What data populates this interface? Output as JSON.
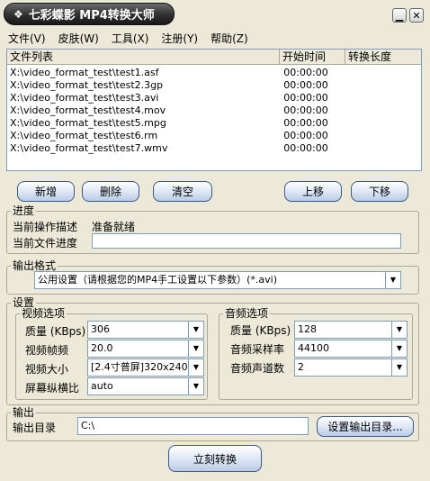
{
  "window": {
    "title": "七彩蝶影 MP4转换大师"
  },
  "menu": [
    "文件(V)",
    "皮肤(W)",
    "工具(X)",
    "注册(Y)",
    "帮助(Z)"
  ],
  "list": {
    "headers": [
      "文件列表",
      "开始时间",
      "转换长度"
    ],
    "rows": [
      {
        "file": "X:\\video_format_test\\test1.asf",
        "start": "00:00:00",
        "length": ""
      },
      {
        "file": "X:\\video_format_test\\test2.3gp",
        "start": "00:00:00",
        "length": ""
      },
      {
        "file": "X:\\video_format_test\\test3.avi",
        "start": "00:00:00",
        "length": ""
      },
      {
        "file": "X:\\video_format_test\\test4.mov",
        "start": "00:00:00",
        "length": ""
      },
      {
        "file": "X:\\video_format_test\\test5.mpg",
        "start": "00:00:00",
        "length": ""
      },
      {
        "file": "X:\\video_format_test\\test6.rm",
        "start": "00:00:00",
        "length": ""
      },
      {
        "file": "X:\\video_format_test\\test7.wmv",
        "start": "00:00:00",
        "length": ""
      }
    ]
  },
  "buttons": {
    "add": "新增",
    "delete": "删除",
    "clear": "清空",
    "up": "上移",
    "down": "下移"
  },
  "progress": {
    "group": "进度",
    "desc_label": "当前操作描述",
    "desc_value": "准备就绪",
    "file_label": "当前文件进度",
    "file_progress": 0
  },
  "format": {
    "group": "输出格式",
    "value": "公用设置（请根据您的MP4手工设置以下参数）(*.avi)"
  },
  "settings": {
    "group": "设置",
    "video": {
      "group": "视频选项",
      "quality_label": "质量 (KBps)",
      "quality": "306",
      "fps_label": "视频帧频",
      "fps": "20.0",
      "size_label": "视频大小",
      "size": "[2.4寸普屏]320x240",
      "aspect_label": "屏幕纵横比",
      "aspect": "auto"
    },
    "audio": {
      "group": "音频选项",
      "quality_label": "质量 (KBps)",
      "quality": "128",
      "rate_label": "音频采样率",
      "rate": "44100",
      "channels_label": "音频声道数",
      "channels": "2"
    }
  },
  "output": {
    "group": "输出",
    "dir_label": "输出目录",
    "dir": "C:\\",
    "set_dir_button": "设置输出目录..."
  },
  "convert_button": "立刻转换"
}
